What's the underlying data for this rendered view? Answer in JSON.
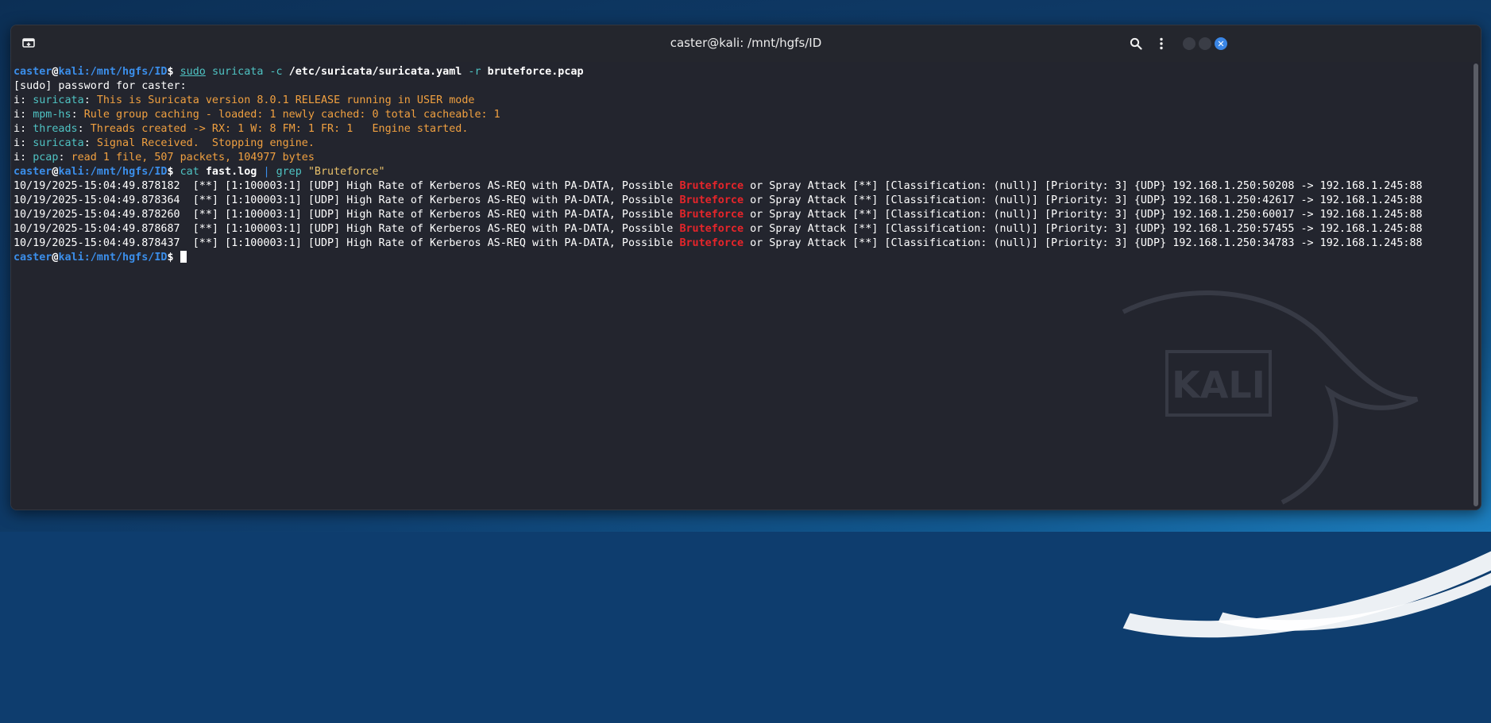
{
  "window": {
    "title": "caster@kali: /mnt/hgfs/ID",
    "new_tab_icon": "new-tab-icon",
    "search_icon": "search-icon",
    "menu_icon": "kebab-menu-icon",
    "close_icon": "close-icon"
  },
  "prompt": {
    "user": "caster",
    "at": "@",
    "host": "kali",
    "path": ":/mnt/hgfs/ID",
    "symbol": "$"
  },
  "cmd1": {
    "sudo": "sudo",
    "prog": "suricata",
    "flag_c": "-c",
    "config": "/etc/suricata/suricata.yaml",
    "flag_r": "-r",
    "pcap": "bruteforce.pcap"
  },
  "sudo_prompt": "[sudo] password for caster:",
  "info_lines": [
    {
      "prefix": "i",
      "module": "suricata",
      "message": "This is Suricata version 8.0.1 RELEASE running in USER mode"
    },
    {
      "prefix": "i",
      "module": "mpm-hs",
      "message": "Rule group caching - loaded: 1 newly cached: 0 total cacheable: 1"
    },
    {
      "prefix": "i",
      "module": "threads",
      "message": "Threads created -> RX: 1 W: 8 FM: 1 FR: 1   Engine started."
    },
    {
      "prefix": "i",
      "module": "suricata",
      "message": "Signal Received.  Stopping engine."
    },
    {
      "prefix": "i",
      "module": "pcap",
      "message": "read 1 file, 507 packets, 104977 bytes"
    }
  ],
  "cmd2": {
    "cat": "cat",
    "file": "fast.log",
    "pipe": "|",
    "grep": "grep",
    "pattern": "\"Bruteforce\""
  },
  "alerts": [
    {
      "time": "10/19/2025-15:04:49.878182",
      "pre": "  [**] [1:100003:1] [UDP] High Rate of Kerberos AS-REQ with PA-DATA, Possible ",
      "match": "Bruteforce",
      "post": " or Spray Attack [**] [Classification: (null)] [Priority: 3] {UDP} 192.168.1.250:50208 -> 192.168.1.245:88"
    },
    {
      "time": "10/19/2025-15:04:49.878364",
      "pre": "  [**] [1:100003:1] [UDP] High Rate of Kerberos AS-REQ with PA-DATA, Possible ",
      "match": "Bruteforce",
      "post": " or Spray Attack [**] [Classification: (null)] [Priority: 3] {UDP} 192.168.1.250:42617 -> 192.168.1.245:88"
    },
    {
      "time": "10/19/2025-15:04:49.878260",
      "pre": "  [**] [1:100003:1] [UDP] High Rate of Kerberos AS-REQ with PA-DATA, Possible ",
      "match": "Bruteforce",
      "post": " or Spray Attack [**] [Classification: (null)] [Priority: 3] {UDP} 192.168.1.250:60017 -> 192.168.1.245:88"
    },
    {
      "time": "10/19/2025-15:04:49.878687",
      "pre": "  [**] [1:100003:1] [UDP] High Rate of Kerberos AS-REQ with PA-DATA, Possible ",
      "match": "Bruteforce",
      "post": " or Spray Attack [**] [Classification: (null)] [Priority: 3] {UDP} 192.168.1.250:57455 -> 192.168.1.245:88"
    },
    {
      "time": "10/19/2025-15:04:49.878437",
      "pre": "  [**] [1:100003:1] [UDP] High Rate of Kerberos AS-REQ with PA-DATA, Possible ",
      "match": "Bruteforce",
      "post": " or Spray Attack [**] [Classification: (null)] [Priority: 3] {UDP} 192.168.1.250:34783 -> 192.168.1.245:88"
    }
  ],
  "watermark_text": "KALI",
  "colors": {
    "prompt": "#3b8eea",
    "command": "#4fc3c3",
    "info_message": "#f0a040",
    "match_highlight": "#e5252a",
    "close_button": "#3a86e6"
  }
}
